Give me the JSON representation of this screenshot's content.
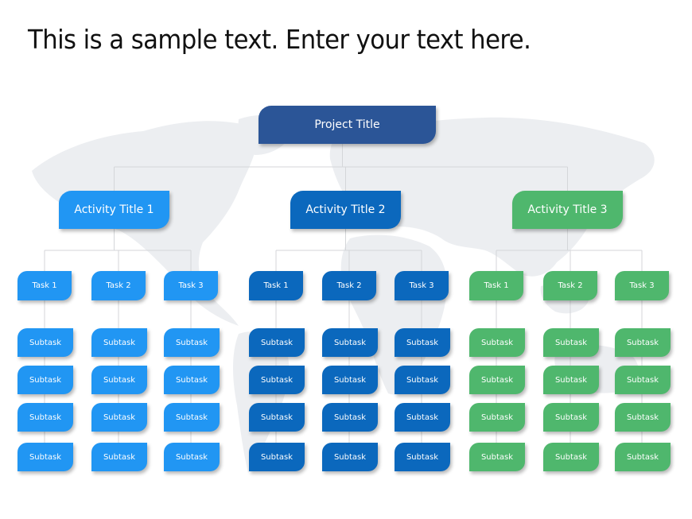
{
  "headline": "This is a sample text. Enter your text here.",
  "colors": {
    "project": "#2b5597",
    "connector": "#d4d6d9",
    "map": "#eceef1"
  },
  "project": {
    "label": "Project Title"
  },
  "activities": [
    {
      "label": "Activity Title 1",
      "color": "#2196f3",
      "tasks": [
        {
          "label": "Task 1",
          "subtasks": [
            "Subtask",
            "Subtask",
            "Subtask",
            "Subtask"
          ]
        },
        {
          "label": "Task 2",
          "subtasks": [
            "Subtask",
            "Subtask",
            "Subtask",
            "Subtask"
          ]
        },
        {
          "label": "Task 3",
          "subtasks": [
            "Subtask",
            "Subtask",
            "Subtask",
            "Subtask"
          ]
        }
      ]
    },
    {
      "label": "Activity Title 2",
      "color": "#0b68bd",
      "tasks": [
        {
          "label": "Task 1",
          "subtasks": [
            "Subtask",
            "Subtask",
            "Subtask",
            "Subtask"
          ]
        },
        {
          "label": "Task 2",
          "subtasks": [
            "Subtask",
            "Subtask",
            "Subtask",
            "Subtask"
          ]
        },
        {
          "label": "Task 3",
          "subtasks": [
            "Subtask",
            "Subtask",
            "Subtask",
            "Subtask"
          ]
        }
      ]
    },
    {
      "label": "Activity Title 3",
      "color": "#4fb76d",
      "tasks": [
        {
          "label": "Task 1",
          "subtasks": [
            "Subtask",
            "Subtask",
            "Subtask",
            "Subtask"
          ]
        },
        {
          "label": "Task 2",
          "subtasks": [
            "Subtask",
            "Subtask",
            "Subtask",
            "Subtask"
          ]
        },
        {
          "label": "Task 3",
          "subtasks": [
            "Subtask",
            "Subtask",
            "Subtask",
            "Subtask"
          ]
        }
      ]
    }
  ]
}
